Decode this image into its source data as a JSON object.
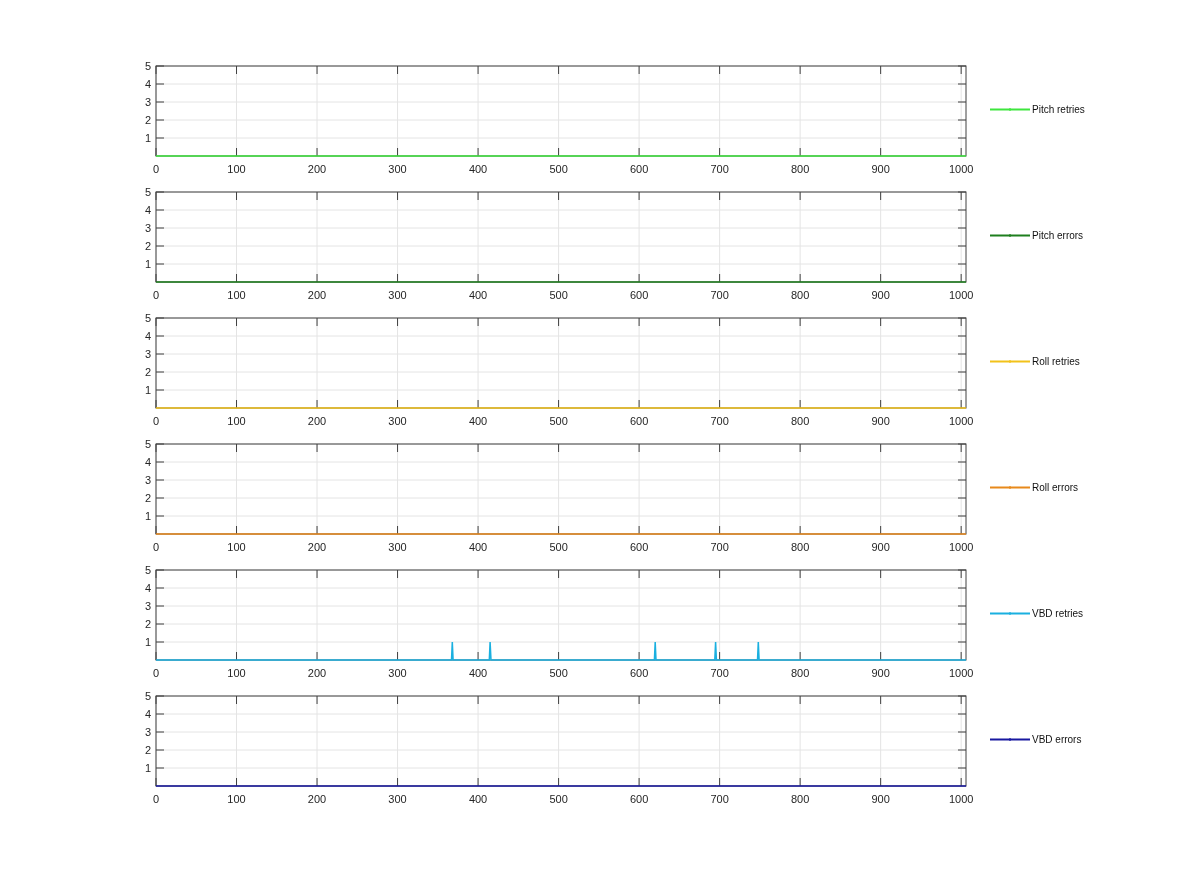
{
  "subplots": [
    {
      "chart_data": {
        "type": "line",
        "grid": true,
        "xlim": [
          0,
          1006
        ],
        "ylim": [
          0,
          5
        ],
        "xticks": [
          0,
          100,
          200,
          300,
          400,
          500,
          600,
          700,
          800,
          900,
          1000
        ],
        "yticks": [
          1,
          2,
          3,
          4,
          5
        ],
        "x": [
          0,
          1006
        ],
        "series": [
          {
            "name": "Pitch retries",
            "color": "#3ee63e",
            "values": [
              0,
              0
            ]
          }
        ]
      }
    },
    {
      "chart_data": {
        "type": "line",
        "grid": true,
        "xlim": [
          0,
          1006
        ],
        "ylim": [
          0,
          5
        ],
        "xticks": [
          0,
          100,
          200,
          300,
          400,
          500,
          600,
          700,
          800,
          900,
          1000
        ],
        "yticks": [
          1,
          2,
          3,
          4,
          5
        ],
        "x": [
          0,
          1006
        ],
        "series": [
          {
            "name": "Pitch errors",
            "color": "#1e7f1e",
            "values": [
              0,
              0
            ]
          }
        ]
      }
    },
    {
      "chart_data": {
        "type": "line",
        "grid": true,
        "xlim": [
          0,
          1006
        ],
        "ylim": [
          0,
          5
        ],
        "xticks": [
          0,
          100,
          200,
          300,
          400,
          500,
          600,
          700,
          800,
          900,
          1000
        ],
        "yticks": [
          1,
          2,
          3,
          4,
          5
        ],
        "x": [
          0,
          1006
        ],
        "series": [
          {
            "name": "Roll retries",
            "color": "#f2c21a",
            "values": [
              0,
              0
            ]
          }
        ]
      }
    },
    {
      "chart_data": {
        "type": "line",
        "grid": true,
        "xlim": [
          0,
          1006
        ],
        "ylim": [
          0,
          5
        ],
        "xticks": [
          0,
          100,
          200,
          300,
          400,
          500,
          600,
          700,
          800,
          900,
          1000
        ],
        "yticks": [
          1,
          2,
          3,
          4,
          5
        ],
        "x": [
          0,
          1006
        ],
        "series": [
          {
            "name": "Roll errors",
            "color": "#e8891b",
            "values": [
              0,
              0
            ]
          }
        ]
      }
    },
    {
      "chart_data": {
        "type": "line",
        "grid": true,
        "xlim": [
          0,
          1006
        ],
        "ylim": [
          0,
          5
        ],
        "xticks": [
          0,
          100,
          200,
          300,
          400,
          500,
          600,
          700,
          800,
          900,
          1000
        ],
        "yticks": [
          1,
          2,
          3,
          4,
          5
        ],
        "x": [
          0,
          367,
          368,
          369,
          414,
          415,
          416,
          619,
          620,
          621,
          694,
          695,
          696,
          747,
          748,
          749,
          1006
        ],
        "series": [
          {
            "name": "VBD retries",
            "color": "#1ab0e0",
            "values": [
              0,
              0,
              1,
              0,
              0,
              1,
              0,
              0,
              1,
              0,
              0,
              1,
              0,
              0,
              1,
              0,
              0
            ]
          }
        ]
      }
    },
    {
      "chart_data": {
        "type": "line",
        "grid": true,
        "xlim": [
          0,
          1006
        ],
        "ylim": [
          0,
          5
        ],
        "xticks": [
          0,
          100,
          200,
          300,
          400,
          500,
          600,
          700,
          800,
          900,
          1000
        ],
        "yticks": [
          1,
          2,
          3,
          4,
          5
        ],
        "x": [
          0,
          1006
        ],
        "series": [
          {
            "name": "VBD errors",
            "color": "#1818a0",
            "values": [
              0,
              0
            ]
          }
        ]
      }
    }
  ]
}
